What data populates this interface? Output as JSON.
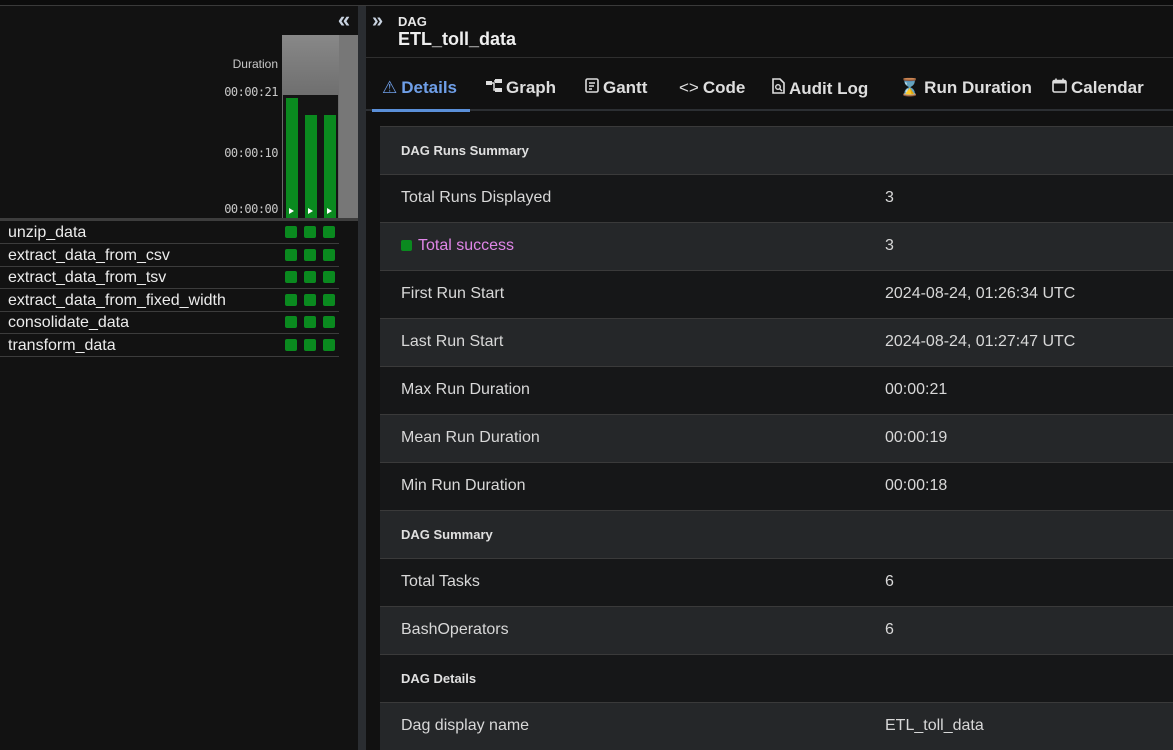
{
  "grid": {
    "duration_label": "Duration",
    "ticks": [
      "00:00:21",
      "00:00:10",
      "00:00:00"
    ],
    "runs": [
      {
        "duration_seconds": 21,
        "state": "success"
      },
      {
        "duration_seconds": 18,
        "state": "success"
      },
      {
        "duration_seconds": 18,
        "state": "success"
      }
    ],
    "tasks": [
      {
        "name": "unzip_data",
        "states": [
          "success",
          "success",
          "success"
        ]
      },
      {
        "name": "extract_data_from_csv",
        "states": [
          "success",
          "success",
          "success"
        ]
      },
      {
        "name": "extract_data_from_tsv",
        "states": [
          "success",
          "success",
          "success"
        ]
      },
      {
        "name": "extract_data_from_fixed_width",
        "states": [
          "success",
          "success",
          "success"
        ]
      },
      {
        "name": "consolidate_data",
        "states": [
          "success",
          "success",
          "success"
        ]
      },
      {
        "name": "transform_data",
        "states": [
          "success",
          "success",
          "success"
        ]
      }
    ]
  },
  "header": {
    "label": "DAG",
    "title": "ETL_toll_data"
  },
  "tabs": [
    {
      "label": "Details",
      "icon": "warning-triangle-icon"
    },
    {
      "label": "Graph",
      "icon": "graph-icon"
    },
    {
      "label": "Gantt",
      "icon": "gantt-icon"
    },
    {
      "label": "Code",
      "icon": "code-icon"
    },
    {
      "label": "Audit Log",
      "icon": "document-search-icon"
    },
    {
      "label": "Run Duration",
      "icon": "hourglass-icon"
    },
    {
      "label": "Calendar",
      "icon": "calendar-icon"
    }
  ],
  "details": {
    "runs_summary_header": "DAG Runs Summary",
    "total_runs_label": "Total Runs Displayed",
    "total_runs_value": "3",
    "total_success_label": "Total success",
    "total_success_value": "3",
    "first_run_label": "First Run Start",
    "first_run_value": "2024-08-24, 01:26:34 UTC",
    "last_run_label": "Last Run Start",
    "last_run_value": "2024-08-24, 01:27:47 UTC",
    "max_dur_label": "Max Run Duration",
    "max_dur_value": "00:00:21",
    "mean_dur_label": "Mean Run Duration",
    "mean_dur_value": "00:00:19",
    "min_dur_label": "Min Run Duration",
    "min_dur_value": "00:00:18",
    "dag_summary_header": "DAG Summary",
    "total_tasks_label": "Total Tasks",
    "total_tasks_value": "6",
    "bash_label": "BashOperators",
    "bash_value": "6",
    "dag_details_header": "DAG Details",
    "display_name_label": "Dag display name",
    "display_name_value": "ETL_toll_data"
  },
  "colors": {
    "success": "#0a8a1f",
    "accent": "#5a8fd8",
    "success_text": "#e086e8"
  }
}
